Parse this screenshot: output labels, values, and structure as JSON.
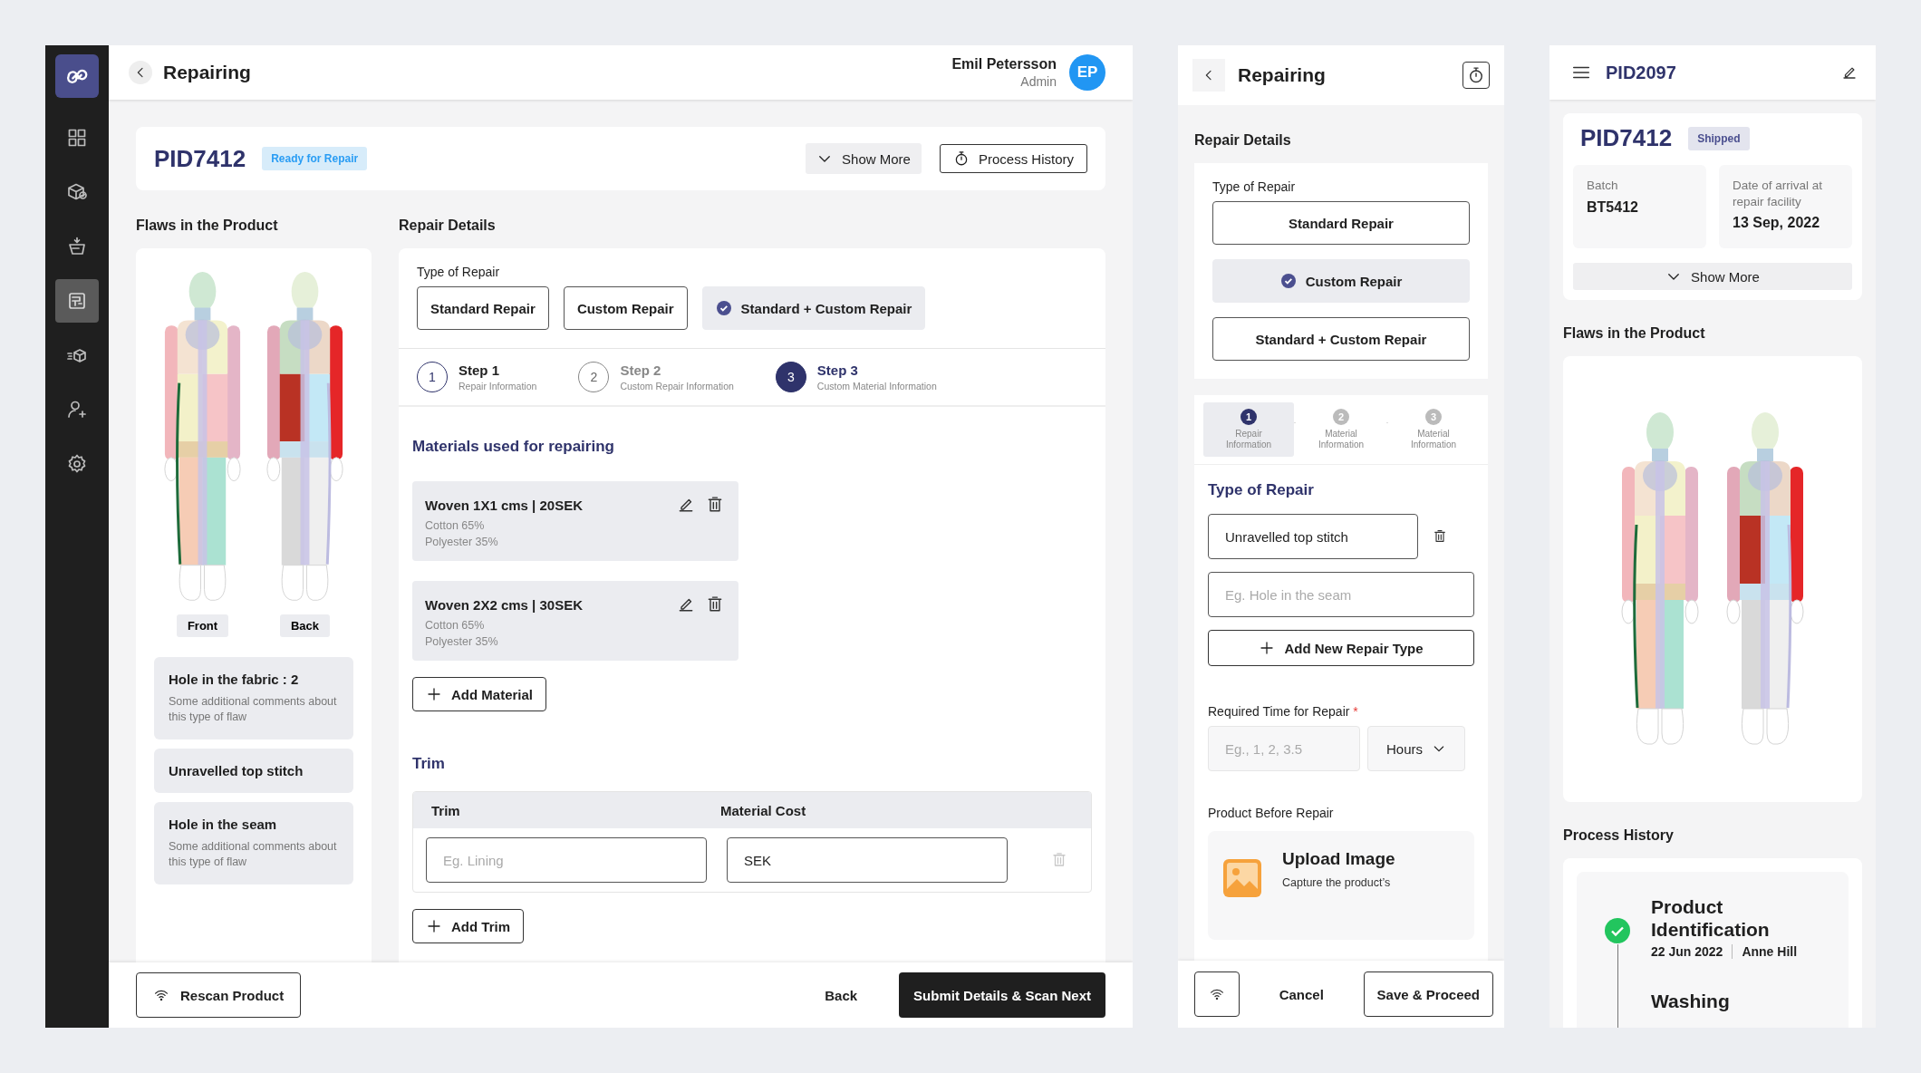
{
  "sidebar": {
    "items": [
      {
        "selected": false
      },
      {
        "selected": false
      },
      {
        "selected": false
      },
      {
        "selected": true
      },
      {
        "selected": false
      },
      {
        "selected": false
      },
      {
        "selected": false
      }
    ]
  },
  "header": {
    "title": "Repairing",
    "user_name": "Emil Petersson",
    "user_role": "Admin",
    "avatar_initials": "EP"
  },
  "product": {
    "id": "PID7412",
    "status": "Ready for Repair",
    "show_more": "Show More",
    "process_history": "Process History"
  },
  "flaws": {
    "title": "Flaws in the Product",
    "views": [
      "Front",
      "Back"
    ],
    "items": [
      {
        "title": "Hole in the fabric : 2",
        "comment": "Some additional comments about this type of flaw"
      },
      {
        "title": "Unravelled top stitch"
      },
      {
        "title": "Hole in the seam",
        "comment": "Some additional comments about this type of flaw"
      }
    ]
  },
  "repair": {
    "title": "Repair Details",
    "type_label": "Type of Repair",
    "types": [
      {
        "label": "Standard Repair",
        "selected": false
      },
      {
        "label": "Custom Repair",
        "selected": false
      },
      {
        "label": "Standard + Custom Repair",
        "selected": true
      }
    ],
    "steps": [
      {
        "number": "1",
        "title": "Step 1",
        "subtitle": "Repair Information",
        "completed": true,
        "selected": false
      },
      {
        "number": "2",
        "title": "Step 2",
        "subtitle": "Custom Repair Information",
        "completed": false,
        "selected": false
      },
      {
        "number": "3",
        "title": "Step 3",
        "subtitle": "Custom Material Information",
        "completed": false,
        "selected": true
      }
    ],
    "materials_title": "Materials used for repairing",
    "materials": [
      {
        "name": "Woven 1X1 cms | 20SEK",
        "lines": [
          "Cotton 65%",
          "Polyester 35%"
        ]
      },
      {
        "name": "Woven 2X2 cms | 30SEK",
        "lines": [
          "Cotton 65%",
          "Polyester 35%"
        ]
      }
    ],
    "add_material": "Add Material",
    "trim_title": "Trim",
    "trim_columns": [
      "Trim",
      "Material Cost"
    ],
    "trim_rows": [
      {
        "trim_placeholder": "Eg. Lining",
        "cost_value": "SEK"
      }
    ],
    "add_trim": "Add Trim"
  },
  "footer": {
    "rescan": "Rescan Product",
    "back": "Back",
    "submit": "Submit Details & Scan Next"
  },
  "mobile_repair": {
    "title": "Repairing",
    "section_title": "Repair Details",
    "type_label": "Type of Repair",
    "types": [
      {
        "label": "Standard Repair",
        "selected": false
      },
      {
        "label": "Custom Repair",
        "selected": true
      },
      {
        "label": "Standard + Custom Repair",
        "selected": false
      }
    ],
    "steps": [
      {
        "number": "1",
        "label": "Repair Information",
        "selected": true
      },
      {
        "number": "2",
        "label": "Material Information",
        "selected": false
      },
      {
        "number": "3",
        "label": "Material Information",
        "selected": false
      }
    ],
    "repair_type_title": "Type of Repair",
    "repair_types": [
      {
        "value": "Unravelled top stitch"
      }
    ],
    "new_repair_placeholder": "Eg. Hole in the seam",
    "add_repair_type": "Add New Repair Type",
    "time": {
      "label": "Required Time for Repair",
      "required_mark": "*",
      "placeholder": "Eg., 1, 2, 3.5",
      "unit": "Hours"
    },
    "upload": {
      "label": "Product Before Repair",
      "title": "Upload Image",
      "text": "Capture the product’s"
    },
    "cancel": "Cancel",
    "save": "Save & Proceed"
  },
  "mobile_product": {
    "title": "PID2097",
    "product_id": "PID7412",
    "status": "Shipped",
    "details": [
      {
        "label": "Batch",
        "value": "BT5412"
      },
      {
        "label": "Date of arrival at repair facility",
        "value": "13 Sep, 2022"
      }
    ],
    "show_more": "Show More",
    "flaws_title": "Flaws in the Product",
    "history_title": "Process History",
    "history": [
      {
        "title": "Product Identification",
        "date": "22 Jun 2022",
        "person": "Anne Hill"
      },
      {
        "title": "Washing"
      }
    ]
  }
}
